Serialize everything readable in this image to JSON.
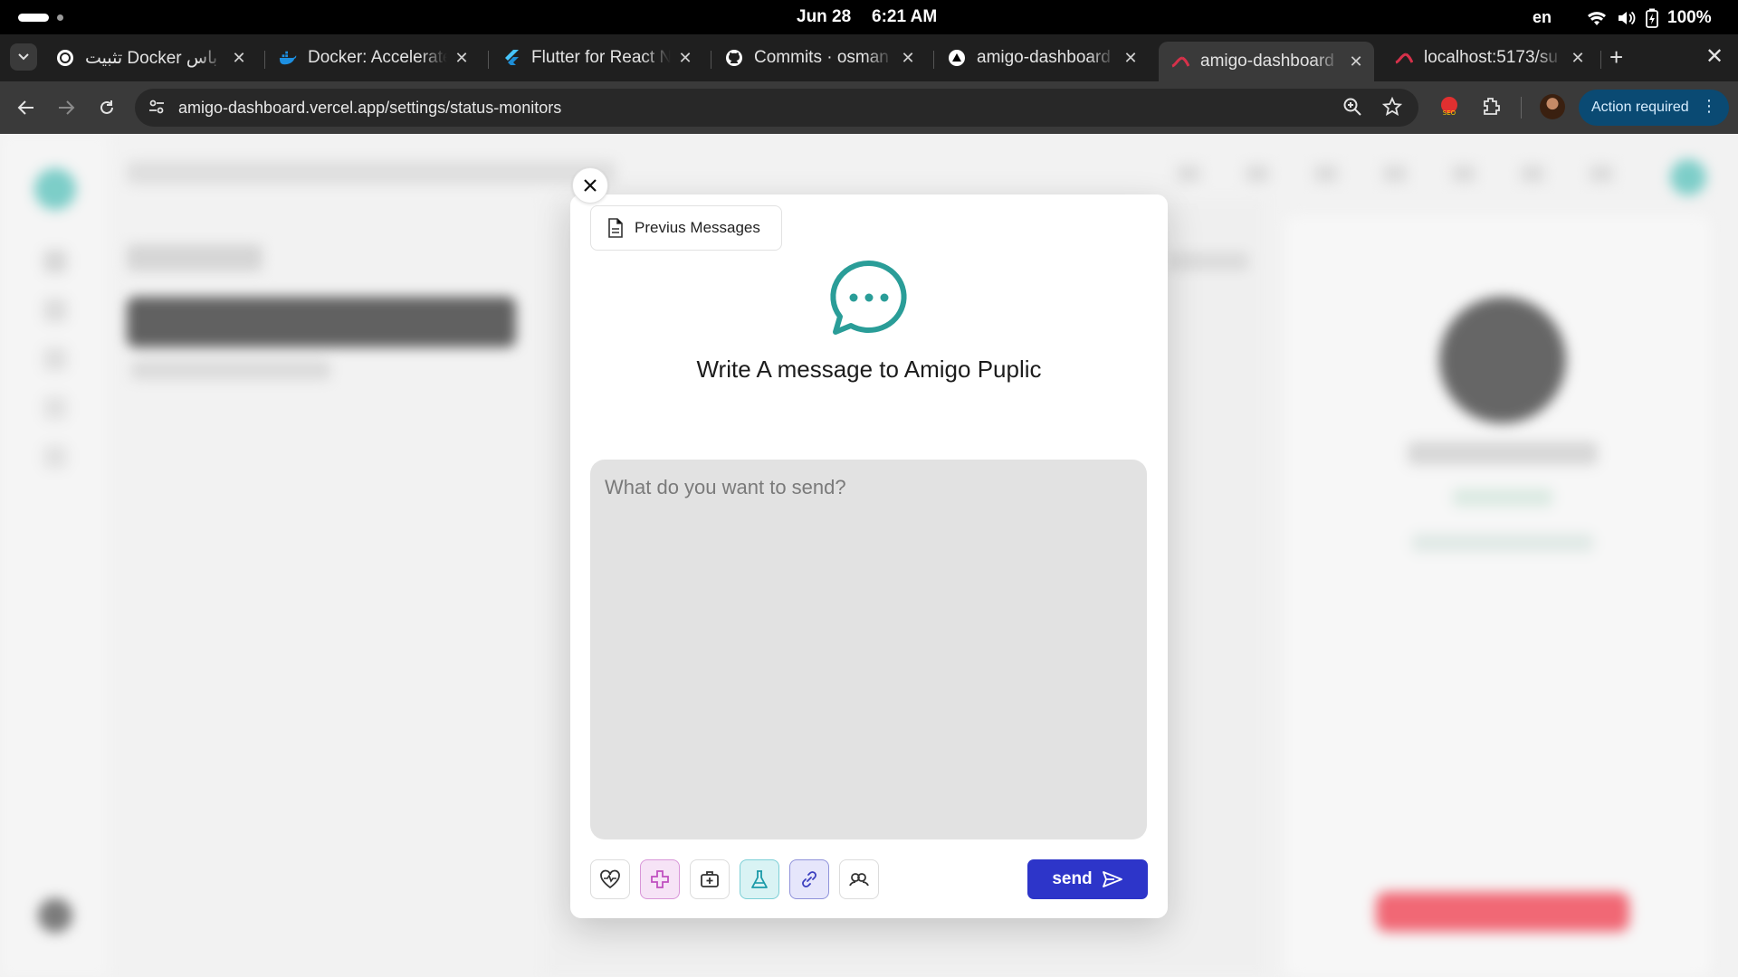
{
  "status_bar": {
    "date": "Jun 28",
    "time": "6:21 AM",
    "language": "en",
    "battery": "100%",
    "icons": [
      "wifi-icon",
      "volume-icon",
      "battery-icon"
    ]
  },
  "tabs": [
    {
      "title": "تثبيت Docker باس",
      "favicon": "chatgpt-icon",
      "active": false
    },
    {
      "title": "Docker: Accelerated",
      "favicon": "docker-icon",
      "active": false
    },
    {
      "title": "Flutter for React Native",
      "favicon": "flutter-icon",
      "active": false
    },
    {
      "title": "Commits · osman",
      "favicon": "github-icon",
      "active": false
    },
    {
      "title": "amigo-dashboard",
      "favicon": "vercel-icon",
      "active": false
    },
    {
      "title": "amigo-dashboard",
      "favicon": "app-icon",
      "active": true
    },
    {
      "title": "localhost:5173/su",
      "favicon": "app-icon",
      "active": false
    }
  ],
  "toolbar": {
    "url": "amigo-dashboard.vercel.app/settings/status-monitors",
    "action_required_label": "Action required"
  },
  "modal": {
    "previous_messages_label": "Previus Messages",
    "title": "Write A message to Amigo Puplic",
    "message_placeholder": "What do you want to send?",
    "message_value": "",
    "send_label": "send",
    "category_buttons": [
      {
        "name": "health-icon",
        "color": "#333333"
      },
      {
        "name": "medical-cross-icon",
        "color": "#c04fc0"
      },
      {
        "name": "first-aid-kit-icon",
        "color": "#333333"
      },
      {
        "name": "lab-flask-icon",
        "color": "#1a9aa8"
      },
      {
        "name": "link-icon",
        "color": "#3b3fbf"
      },
      {
        "name": "users-icon",
        "color": "#333333"
      }
    ]
  },
  "colors": {
    "accent": "#2d35c9",
    "brand_teal": "#2a9d98",
    "backdrop": "#f0f0f0"
  }
}
